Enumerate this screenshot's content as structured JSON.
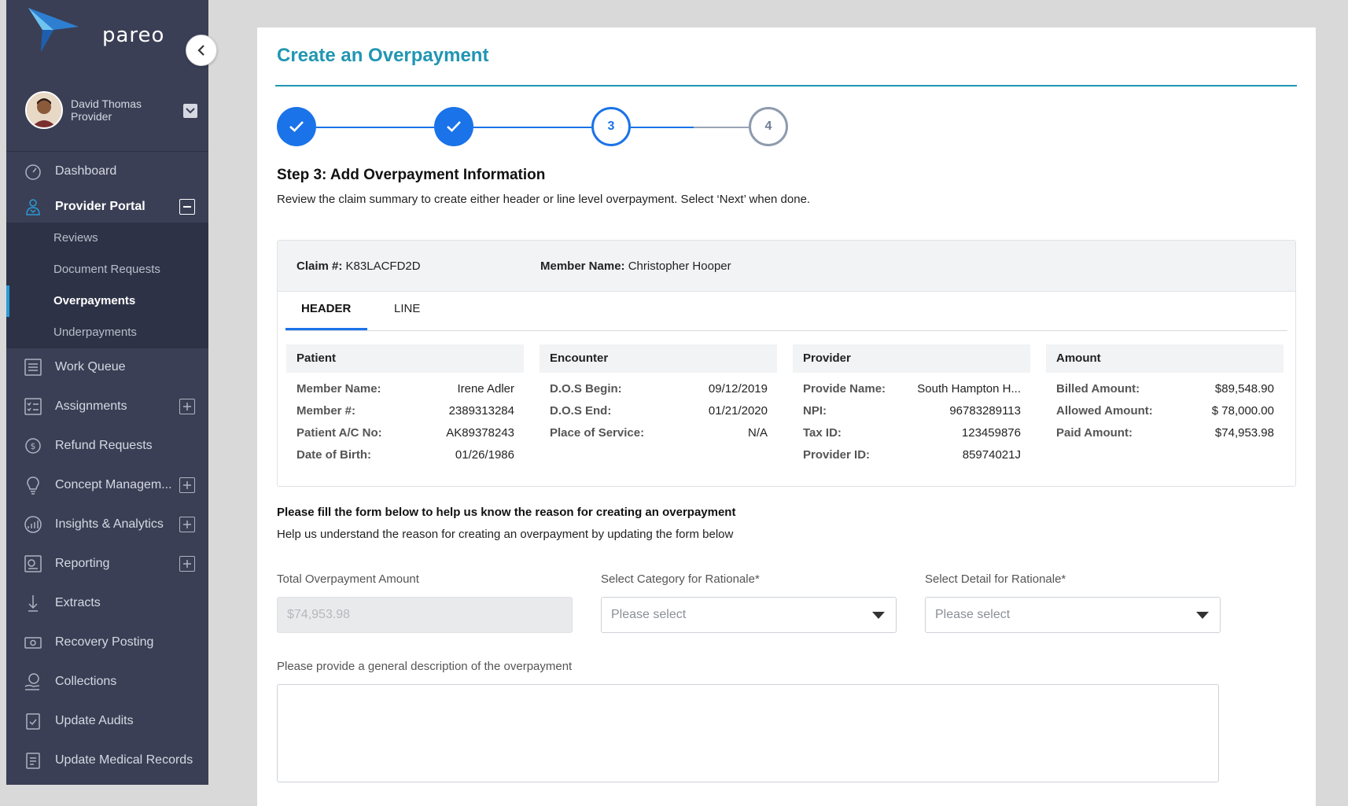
{
  "app": {
    "brand": "pareo"
  },
  "user": {
    "name": "David Thomas",
    "role": "Provider"
  },
  "sidebar": {
    "items": [
      {
        "label": "Dashboard",
        "icon": "dashboard-icon"
      },
      {
        "label": "Provider Portal",
        "icon": "provider-icon",
        "active": true,
        "expanded": true,
        "children": [
          {
            "label": "Reviews"
          },
          {
            "label": "Document Requests"
          },
          {
            "label": "Overpayments",
            "active": true
          },
          {
            "label": "Underpayments"
          }
        ]
      },
      {
        "label": "Work Queue",
        "icon": "list-icon"
      },
      {
        "label": "Assignments",
        "icon": "checklist-icon",
        "expandable": true
      },
      {
        "label": "Refund Requests",
        "icon": "refund-icon"
      },
      {
        "label": "Concept Managem...",
        "icon": "lightbulb-icon",
        "expandable": true
      },
      {
        "label": "Insights & Analytics",
        "icon": "analytics-icon",
        "expandable": true
      },
      {
        "label": "Reporting",
        "icon": "report-icon",
        "expandable": true
      },
      {
        "label": "Extracts",
        "icon": "extract-icon"
      },
      {
        "label": "Recovery Posting",
        "icon": "money-icon"
      },
      {
        "label": "Collections",
        "icon": "collections-icon"
      },
      {
        "label": "Update Audits",
        "icon": "audit-icon"
      },
      {
        "label": "Update Medical Records",
        "icon": "clipboard-icon"
      }
    ]
  },
  "page": {
    "title": "Create an Overpayment",
    "steps": [
      {
        "label": "",
        "state": "done"
      },
      {
        "label": "",
        "state": "done"
      },
      {
        "label": "3",
        "state": "current"
      },
      {
        "label": "4",
        "state": "todo"
      }
    ],
    "step_heading": "Step 3: Add Overpayment Information",
    "step_sub": "Review the claim summary to create either header or line level overpayment. Select ‘Next’ when done."
  },
  "claim": {
    "claim_label": "Claim #:",
    "claim_value": "K83LACFD2D",
    "member_label": "Member Name:",
    "member_value": "Christopher Hooper",
    "tabs": [
      {
        "label": "HEADER",
        "active": true
      },
      {
        "label": "LINE",
        "active": false
      }
    ],
    "sections": {
      "patient": {
        "title": "Patient",
        "rows": [
          {
            "k": "Member Name:",
            "v": "Irene Adler"
          },
          {
            "k": "Member #:",
            "v": "2389313284"
          },
          {
            "k": "Patient A/C No:",
            "v": "AK89378243"
          },
          {
            "k": "Date of Birth:",
            "v": "01/26/1986"
          }
        ]
      },
      "encounter": {
        "title": "Encounter",
        "rows": [
          {
            "k": "D.O.S Begin:",
            "v": "09/12/2019"
          },
          {
            "k": "D.O.S End:",
            "v": "01/21/2020"
          },
          {
            "k": "Place of Service:",
            "v": "N/A"
          }
        ]
      },
      "provider": {
        "title": "Provider",
        "rows": [
          {
            "k": "Provide Name:",
            "v": "South Hampton H..."
          },
          {
            "k": "NPI:",
            "v": "96783289113"
          },
          {
            "k": "Tax ID:",
            "v": "123459876"
          },
          {
            "k": "Provider ID:",
            "v": "85974021J"
          }
        ]
      },
      "amount": {
        "title": "Amount",
        "rows": [
          {
            "k": "Billed Amount:",
            "v": "$89,548.90"
          },
          {
            "k": "Allowed Amount:",
            "v": "$ 78,000.00"
          },
          {
            "k": "Paid Amount:",
            "v": "$74,953.98"
          }
        ]
      }
    }
  },
  "form": {
    "heading": "Please fill the form below to help us know the reason for creating an overpayment",
    "sub": "Help us understand the reason for creating an overpayment by updating the form below",
    "total_label": "Total Overpayment Amount",
    "total_value": "$74,953.98",
    "category_label": "Select Category for Rationale*",
    "category_value": "Please select",
    "detail_label": "Select Detail for Rationale*",
    "detail_value": "Please select",
    "description_label": "Please provide a general description of the overpayment",
    "description_value": ""
  },
  "colors": {
    "accent": "#2196b3",
    "step_blue": "#1a73e8",
    "sidebar_bg": "#3a3f55",
    "submenu_bg": "#2e3246",
    "active_bar": "#2a9bd6"
  }
}
